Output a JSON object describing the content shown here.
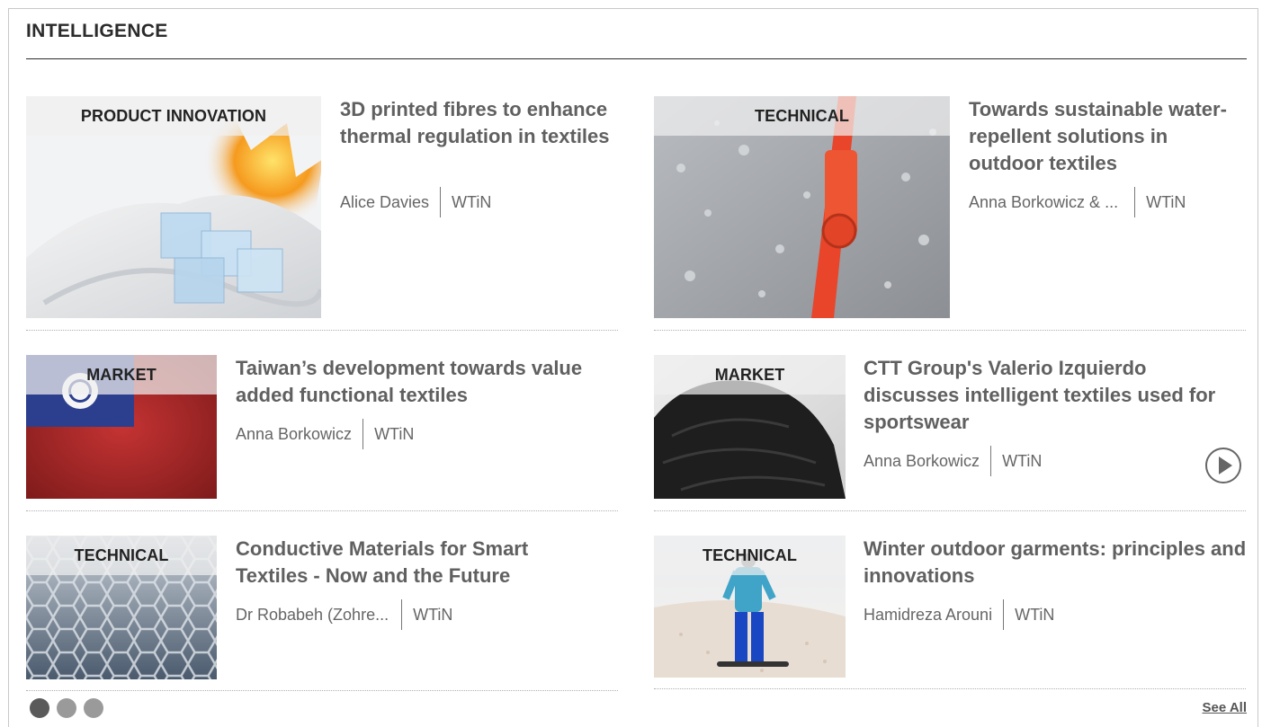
{
  "section": {
    "title": "INTELLIGENCE"
  },
  "articles": [
    {
      "category": "PRODUCT INNOVATION",
      "title": "3D printed fibres to enhance thermal regulation in textiles",
      "author": "Alice Davies",
      "source": "WTiN",
      "image_icon": "fabric-ice-fire-image"
    },
    {
      "category": "TECHNICAL",
      "title": "Towards sustainable water-repellent solutions in outdoor textiles",
      "author": "Anna Borkowicz & ...",
      "source": "WTiN",
      "image_icon": "zipper-droplets-image"
    },
    {
      "category": "MARKET",
      "title": "Taiwan’s development towards value added functional textiles",
      "author": "Anna Borkowicz",
      "source": "WTiN",
      "image_icon": "taiwan-flag-image"
    },
    {
      "category": "MARKET",
      "title": "CTT Group's Valerio Izquierdo discusses intelligent textiles used for sportswear",
      "author": "Anna Borkowicz",
      "source": "WTiN",
      "image_icon": "sportswear-shoulder-image",
      "has_video": true
    },
    {
      "category": "TECHNICAL",
      "title": "Conductive Materials for Smart Textiles - Now and the Future",
      "author": "Dr Robabeh (Zohre...",
      "source": "WTiN",
      "image_icon": "graphene-lattice-image"
    },
    {
      "category": "TECHNICAL",
      "title": "Winter outdoor garments: principles and innovations",
      "author": "Hamidreza Arouni",
      "source": "WTiN",
      "image_icon": "snowboarder-image"
    }
  ],
  "pagination": {
    "pages": 3,
    "active": 1
  },
  "see_all_label": "See All",
  "colors": {
    "title_text": "#606060",
    "heading": "#2b2b2b",
    "tag_bg": "#f0f0f0",
    "flag_red": "#b22a2a",
    "flag_blue": "#2c3f8e",
    "zipper_orange": "#e8452a"
  }
}
